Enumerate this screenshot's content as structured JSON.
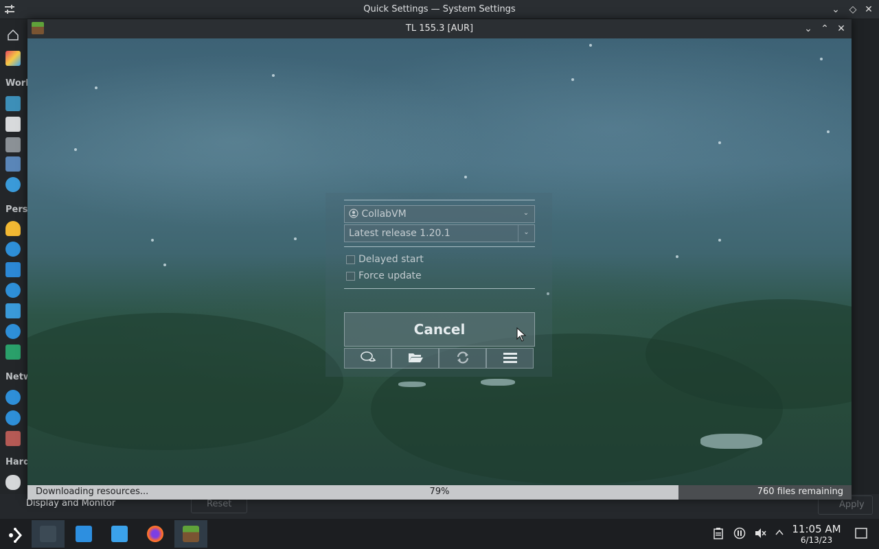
{
  "background_window": {
    "title": "Quick Settings — System Settings",
    "sidebar_sections": [
      "Work",
      "Pers",
      "Netw",
      "Hard"
    ],
    "bottom_item": "Display and Monitor",
    "reset_label": "Reset",
    "apply_label": "Apply"
  },
  "launcher": {
    "title": "TL 155.3 [AUR]",
    "account": "CollabVM",
    "version": "Latest release 1.20.1",
    "delayed_start_label": "Delayed start",
    "force_update_label": "Force update",
    "cancel_label": "Cancel",
    "toolbar_icons": [
      "chat-icon",
      "folder-icon",
      "refresh-icon",
      "menu-icon"
    ]
  },
  "progress": {
    "status": "Downloading resources...",
    "percent_label": "79%",
    "fraction": 0.79,
    "remaining": "760 files remaining"
  },
  "taskbar": {
    "time": "11:05 AM",
    "date": "6/13/23",
    "apps": [
      "app-launcher-icon",
      "system-settings-icon",
      "discover-icon",
      "files-icon",
      "firefox-icon",
      "minecraft-launcher-icon"
    ],
    "tray": [
      "clipboard-icon",
      "media-pause-icon",
      "volume-muted-icon",
      "tray-expand-icon",
      "show-desktop-icon"
    ]
  },
  "colors": {
    "progress_fill": "#c7c9cb",
    "taskbar_active": "#2f3b46"
  }
}
